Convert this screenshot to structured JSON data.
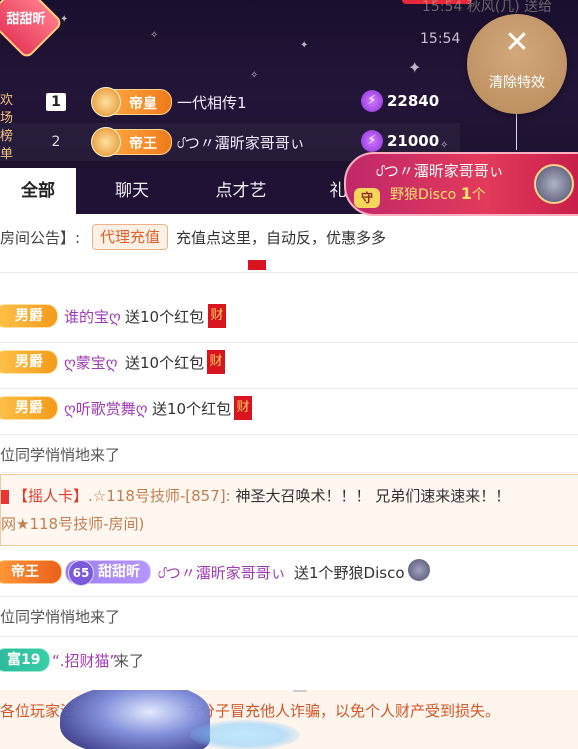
{
  "header": {
    "corner_badge": "甜甜昕",
    "side_label": "欢场榜单",
    "top_faint": "15:54 秋风(几) 送给",
    "time": "15:54",
    "time_suffix": "送给",
    "clear_effects": {
      "icon": "close-icon",
      "label": "清除特效"
    },
    "ranking": [
      {
        "rank": "1",
        "level": "帝皇",
        "name": "一代相传1",
        "score": "22840"
      },
      {
        "rank": "2",
        "level": "帝王",
        "name": "ᦔつ〃澑昕家哥哥ぃ",
        "score": "21000"
      }
    ],
    "gift_banner": {
      "sender": "ᦔつ〃澑昕家哥哥ぃ",
      "gift": "野狼Disco",
      "count": "1",
      "unit": "个",
      "shield": "守"
    }
  },
  "tabs": [
    "全部",
    "聊天",
    "点才艺",
    "礼"
  ],
  "announcement": {
    "prefix": "房间公告】:",
    "tag": "代理充值",
    "text": "充值点这里，自动反，优惠多多"
  },
  "feed": [
    {
      "type": "gift",
      "badge": "男爵",
      "user": "谁的宝ღ",
      "text": "送10个红包",
      "tag": "财"
    },
    {
      "type": "gift",
      "badge": "男爵",
      "user": "ღ蒙宝ღ",
      "text": "送10个红包",
      "tag": "财"
    },
    {
      "type": "gift",
      "badge": "男爵",
      "user": "ღ听歌赏舞ღ",
      "text": "送10个红包",
      "tag": "财"
    },
    {
      "type": "system",
      "text": "位同学悄悄地来了"
    },
    {
      "type": "card",
      "card": "【摇人卡】",
      "sender": ".☆118号技师-[857]:",
      "message": "神圣大召唤术！！！ 兄弟们速来速来！！",
      "room": "网★118号技师-房间)"
    },
    {
      "type": "gift2",
      "badge": "帝王",
      "level": "65",
      "level_name": "甜甜昕",
      "user": "ᦔつ〃澑昕家哥哥ぃ",
      "text": "送1个野狼Disco"
    },
    {
      "type": "system",
      "text": "位同学悄悄地来了"
    },
    {
      "type": "enter",
      "badge": "富19",
      "user": "“.招财猫”",
      "text": "来了"
    }
  ],
  "notice": {
    "text": "各位玩家注意谨防不法分子冒充他人诈骗，以免个人财产受到损失。",
    "visible_text": "各位玩家注",
    "visible_tail": "去分子冒充他人诈骗，以免个人财产受到损失。"
  },
  "colors": {
    "header_bg": "#231538",
    "accent_gold": "#ffb24a",
    "gift_red": "#e23a5a",
    "name_purple": "#a23ab8"
  }
}
